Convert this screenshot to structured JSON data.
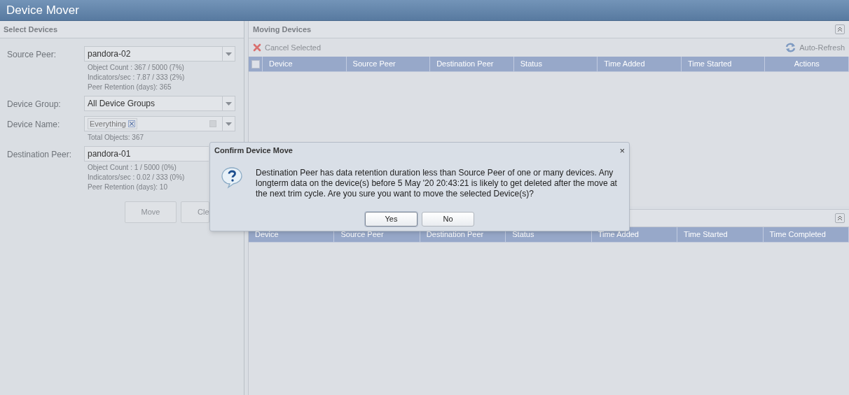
{
  "window": {
    "title": "Device Mover"
  },
  "select_devices": {
    "title": "Select Devices",
    "fields": [
      {
        "label": "Source Peer:",
        "kind": "combo",
        "value": "pandora-02",
        "info": [
          "Object Count : 367 / 5000 (7%)",
          "Indicators/sec : 7.87 / 333 (2%)",
          "Peer Retention (days): 365"
        ]
      },
      {
        "label": "Device Group:",
        "kind": "combo",
        "value": "All Device Groups"
      },
      {
        "label": "Device Name:",
        "kind": "tags",
        "tags": [
          "Everything"
        ],
        "info": [
          "Total Objects: 367"
        ]
      },
      {
        "label": "Destination Peer:",
        "kind": "combo",
        "value": "pandora-01",
        "info": [
          "Object Count : 1 / 5000 (0%)",
          "Indicators/sec : 0.02 / 333 (0%)",
          "Peer Retention (days): 10"
        ]
      }
    ],
    "buttons": [
      "Move",
      "Cle"
    ]
  },
  "moving_devices": {
    "title": "Moving Devices",
    "select_all": {
      "checked": false
    },
    "toolbar": {
      "cancel": "Cancel Selected",
      "refresh": "Auto-Refresh"
    },
    "columns": [
      "Device",
      "Source Peer",
      "Destination Peer",
      "Status",
      "Time Added",
      "Time Started",
      "Actions"
    ]
  },
  "completed_panel": {
    "columns": [
      "Device",
      "Source Peer",
      "Destination Peer",
      "Status",
      "Time Added",
      "Time Started",
      "Time Completed"
    ]
  },
  "dialog": {
    "title": "Confirm Device Move",
    "close": "×",
    "message": "Destination Peer has data retention duration less than Source Peer of one or many devices. Any longterm data on the device(s) before 5 May '20 20:43:21 is likely to get deleted after the move at the next trim cycle. Are you sure you want to move the selected Device(s)?",
    "buttons": [
      {
        "label": "Yes",
        "selected": true
      },
      {
        "label": "No",
        "selected": false
      }
    ]
  }
}
